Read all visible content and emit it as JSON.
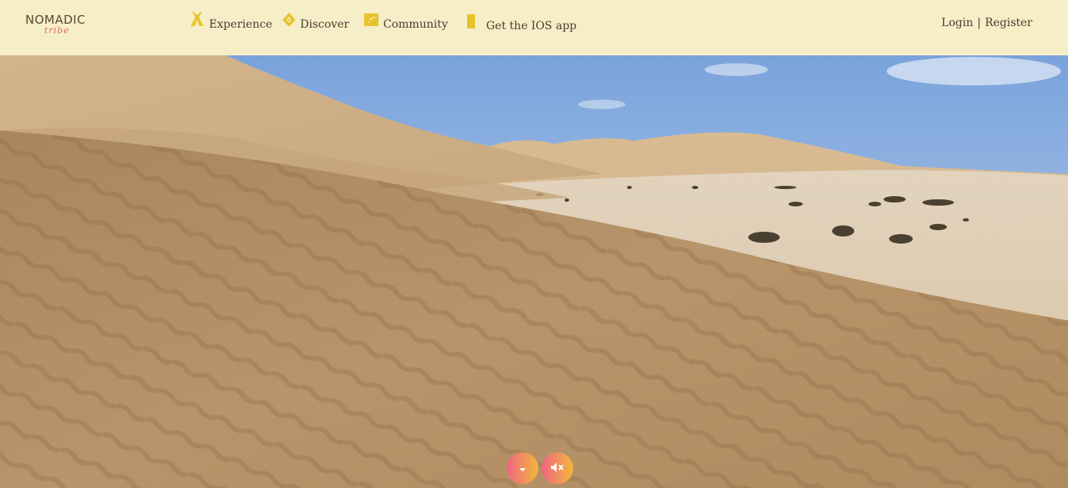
{
  "brand": {
    "name": "NOMADIC",
    "tagline": "tribe"
  },
  "nav": {
    "items": [
      {
        "label": "Experience",
        "icon": "tent-icon"
      },
      {
        "label": "Discover",
        "icon": "compass-diamond-icon"
      },
      {
        "label": "Community",
        "icon": "community-square-icon"
      },
      {
        "label": "Get the IOS app",
        "icon": "phone-icon"
      }
    ]
  },
  "auth": {
    "login": "Login",
    "separator": "|",
    "register": "Register"
  },
  "hero": {
    "scene": "desert-dunes-video"
  },
  "controls": {
    "scroll_down_icon": "caret-down-icon",
    "mute_icon": "speaker-mute-icon"
  },
  "colors": {
    "navbar_bg": "#f6eec7",
    "icon_yellow": "#e8c22a",
    "text": "#4a3c30",
    "button_gradient_start": "#ef6585",
    "button_gradient_end": "#f2b73a"
  }
}
